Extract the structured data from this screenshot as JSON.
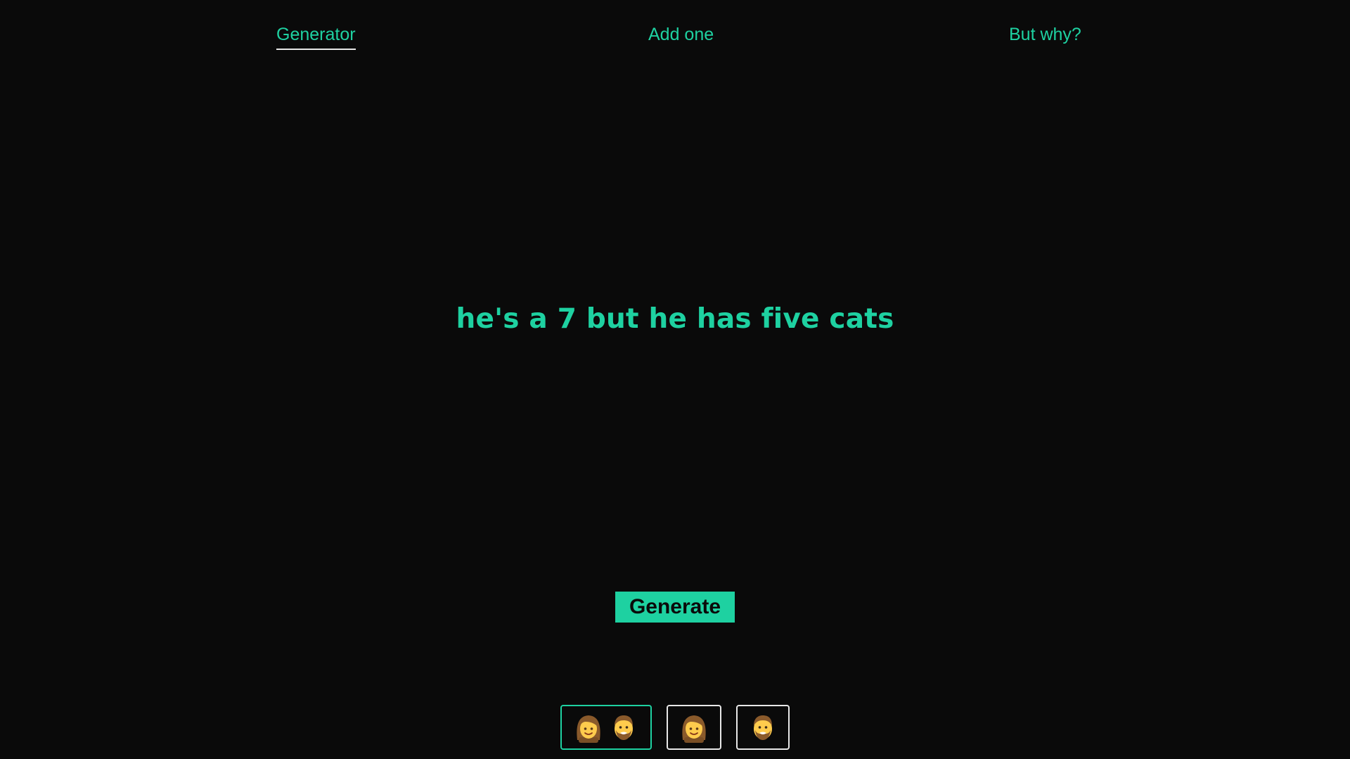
{
  "nav": {
    "items": [
      {
        "label": "Generator",
        "active": true
      },
      {
        "label": "Add one",
        "active": false
      },
      {
        "label": "But why?",
        "active": false
      }
    ]
  },
  "main": {
    "headline": "he's a 7 but he has five cats"
  },
  "actions": {
    "generate_label": "Generate"
  },
  "filters": [
    {
      "icons": [
        "woman-emoji-icon",
        "man-emoji-icon"
      ],
      "selected": true
    },
    {
      "icons": [
        "woman-emoji-icon"
      ],
      "selected": false
    },
    {
      "icons": [
        "man-emoji-icon"
      ],
      "selected": false
    }
  ],
  "colors": {
    "background": "#0a0a0a",
    "accent": "#1ed1a1",
    "border": "#e8e8e8"
  }
}
